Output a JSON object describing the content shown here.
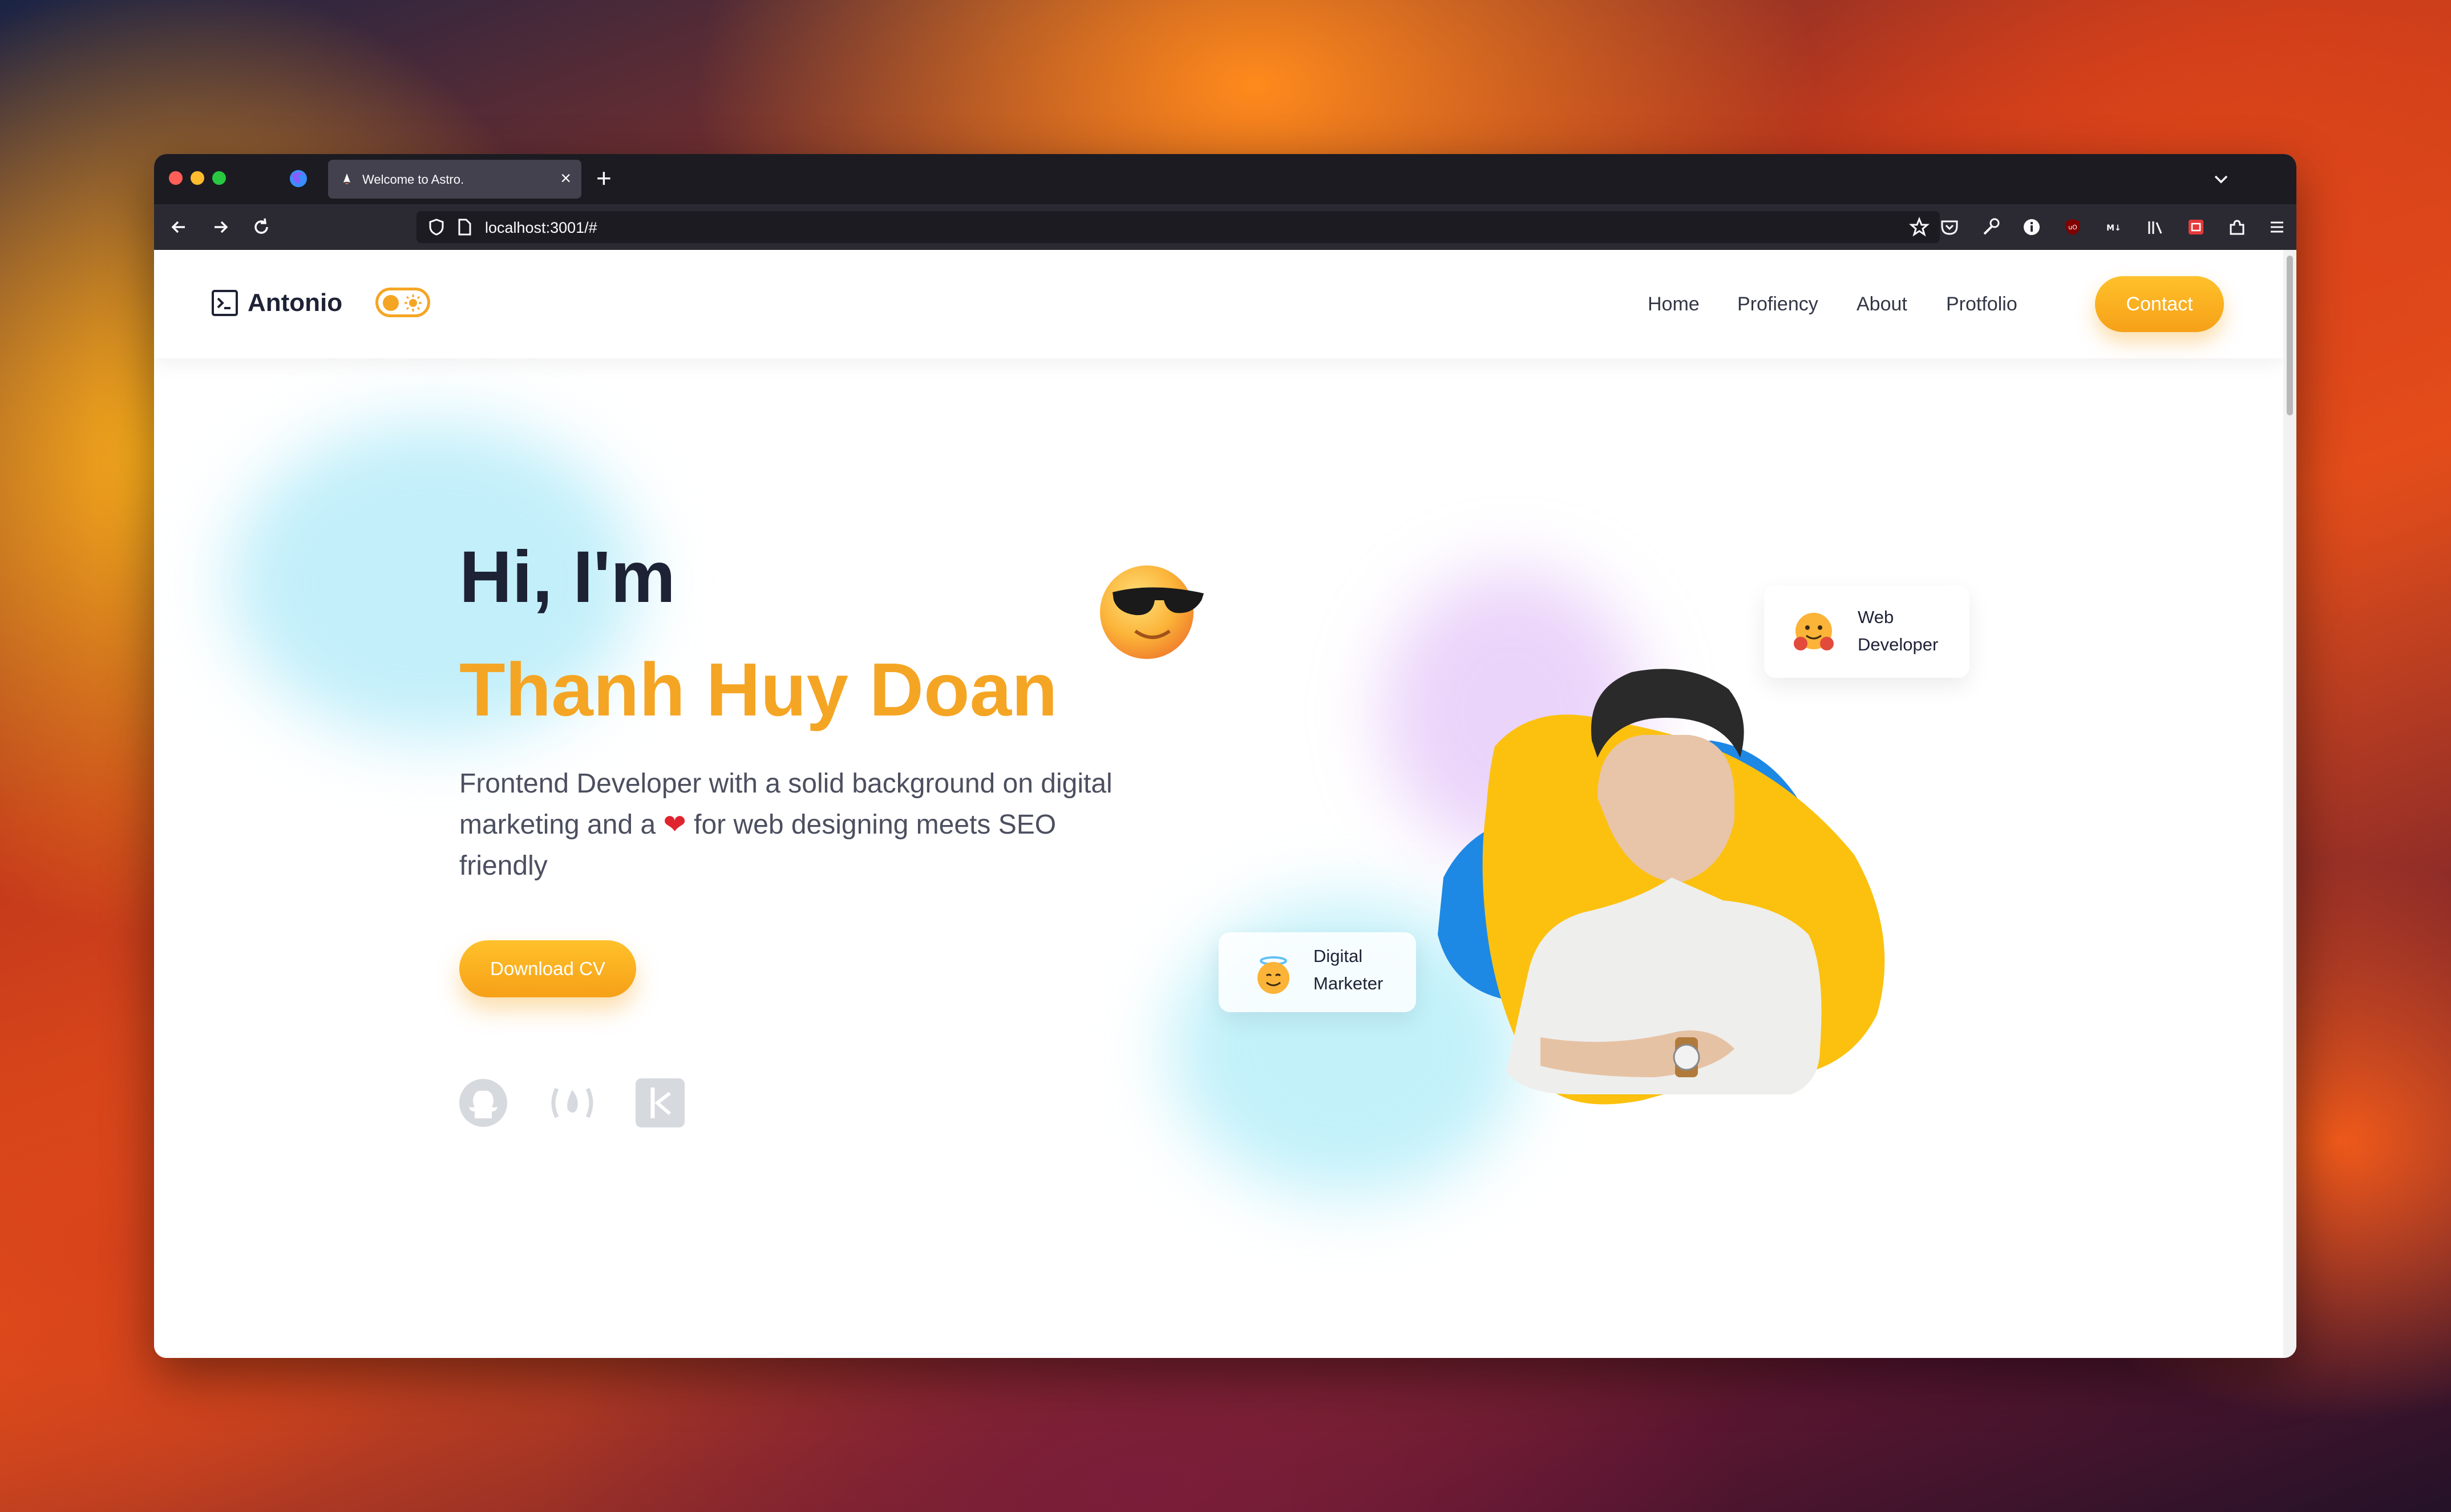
{
  "browser": {
    "tab_title": "Welcome to Astro.",
    "url": "localhost:3001/#"
  },
  "site": {
    "logo_text": "Antonio",
    "nav": [
      "Home",
      "Profiency",
      "About",
      "Protfolio"
    ],
    "contact_label": "Contact"
  },
  "hero": {
    "greeting": "Hi, I'm",
    "name": "Thanh Huy Doan",
    "desc_before": "Frontend Developer with a solid background on digital marketing and a ",
    "desc_heart": "❤",
    "desc_after": " for web designing meets SEO friendly",
    "download_label": "Download CV"
  },
  "cards": {
    "web_developer": "Web Developer",
    "digital_marketer": "Digital Marketer"
  },
  "icons": {
    "social": [
      "github-icon",
      "freecodecamp-icon",
      "kaggle-icon"
    ],
    "toolbar": [
      "pocket-icon",
      "wrench-icon",
      "info-icon",
      "ublock-icon",
      "markdown-icon",
      "library-icon",
      "screenshot-icon",
      "extensions-icon",
      "menu-icon"
    ]
  },
  "colors": {
    "accent": "#f5a524",
    "text_dark": "#1e2235",
    "blob_yellow": "#fcc10f",
    "blob_blue": "#1e88e5"
  }
}
